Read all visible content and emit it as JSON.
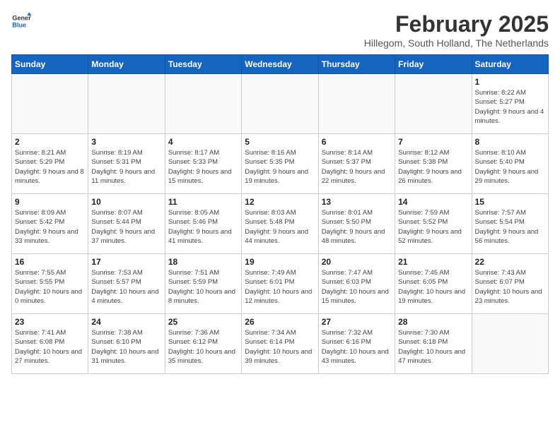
{
  "header": {
    "logo_general": "General",
    "logo_blue": "Blue",
    "month_title": "February 2025",
    "subtitle": "Hillegom, South Holland, The Netherlands"
  },
  "weekdays": [
    "Sunday",
    "Monday",
    "Tuesday",
    "Wednesday",
    "Thursday",
    "Friday",
    "Saturday"
  ],
  "weeks": [
    [
      {
        "day": "",
        "info": ""
      },
      {
        "day": "",
        "info": ""
      },
      {
        "day": "",
        "info": ""
      },
      {
        "day": "",
        "info": ""
      },
      {
        "day": "",
        "info": ""
      },
      {
        "day": "",
        "info": ""
      },
      {
        "day": "1",
        "info": "Sunrise: 8:22 AM\nSunset: 5:27 PM\nDaylight: 9 hours and 4 minutes."
      }
    ],
    [
      {
        "day": "2",
        "info": "Sunrise: 8:21 AM\nSunset: 5:29 PM\nDaylight: 9 hours and 8 minutes."
      },
      {
        "day": "3",
        "info": "Sunrise: 8:19 AM\nSunset: 5:31 PM\nDaylight: 9 hours and 11 minutes."
      },
      {
        "day": "4",
        "info": "Sunrise: 8:17 AM\nSunset: 5:33 PM\nDaylight: 9 hours and 15 minutes."
      },
      {
        "day": "5",
        "info": "Sunrise: 8:16 AM\nSunset: 5:35 PM\nDaylight: 9 hours and 19 minutes."
      },
      {
        "day": "6",
        "info": "Sunrise: 8:14 AM\nSunset: 5:37 PM\nDaylight: 9 hours and 22 minutes."
      },
      {
        "day": "7",
        "info": "Sunrise: 8:12 AM\nSunset: 5:38 PM\nDaylight: 9 hours and 26 minutes."
      },
      {
        "day": "8",
        "info": "Sunrise: 8:10 AM\nSunset: 5:40 PM\nDaylight: 9 hours and 29 minutes."
      }
    ],
    [
      {
        "day": "9",
        "info": "Sunrise: 8:09 AM\nSunset: 5:42 PM\nDaylight: 9 hours and 33 minutes."
      },
      {
        "day": "10",
        "info": "Sunrise: 8:07 AM\nSunset: 5:44 PM\nDaylight: 9 hours and 37 minutes."
      },
      {
        "day": "11",
        "info": "Sunrise: 8:05 AM\nSunset: 5:46 PM\nDaylight: 9 hours and 41 minutes."
      },
      {
        "day": "12",
        "info": "Sunrise: 8:03 AM\nSunset: 5:48 PM\nDaylight: 9 hours and 44 minutes."
      },
      {
        "day": "13",
        "info": "Sunrise: 8:01 AM\nSunset: 5:50 PM\nDaylight: 9 hours and 48 minutes."
      },
      {
        "day": "14",
        "info": "Sunrise: 7:59 AM\nSunset: 5:52 PM\nDaylight: 9 hours and 52 minutes."
      },
      {
        "day": "15",
        "info": "Sunrise: 7:57 AM\nSunset: 5:54 PM\nDaylight: 9 hours and 56 minutes."
      }
    ],
    [
      {
        "day": "16",
        "info": "Sunrise: 7:55 AM\nSunset: 5:55 PM\nDaylight: 10 hours and 0 minutes."
      },
      {
        "day": "17",
        "info": "Sunrise: 7:53 AM\nSunset: 5:57 PM\nDaylight: 10 hours and 4 minutes."
      },
      {
        "day": "18",
        "info": "Sunrise: 7:51 AM\nSunset: 5:59 PM\nDaylight: 10 hours and 8 minutes."
      },
      {
        "day": "19",
        "info": "Sunrise: 7:49 AM\nSunset: 6:01 PM\nDaylight: 10 hours and 12 minutes."
      },
      {
        "day": "20",
        "info": "Sunrise: 7:47 AM\nSunset: 6:03 PM\nDaylight: 10 hours and 15 minutes."
      },
      {
        "day": "21",
        "info": "Sunrise: 7:45 AM\nSunset: 6:05 PM\nDaylight: 10 hours and 19 minutes."
      },
      {
        "day": "22",
        "info": "Sunrise: 7:43 AM\nSunset: 6:07 PM\nDaylight: 10 hours and 23 minutes."
      }
    ],
    [
      {
        "day": "23",
        "info": "Sunrise: 7:41 AM\nSunset: 6:08 PM\nDaylight: 10 hours and 27 minutes."
      },
      {
        "day": "24",
        "info": "Sunrise: 7:38 AM\nSunset: 6:10 PM\nDaylight: 10 hours and 31 minutes."
      },
      {
        "day": "25",
        "info": "Sunrise: 7:36 AM\nSunset: 6:12 PM\nDaylight: 10 hours and 35 minutes."
      },
      {
        "day": "26",
        "info": "Sunrise: 7:34 AM\nSunset: 6:14 PM\nDaylight: 10 hours and 39 minutes."
      },
      {
        "day": "27",
        "info": "Sunrise: 7:32 AM\nSunset: 6:16 PM\nDaylight: 10 hours and 43 minutes."
      },
      {
        "day": "28",
        "info": "Sunrise: 7:30 AM\nSunset: 6:18 PM\nDaylight: 10 hours and 47 minutes."
      },
      {
        "day": "",
        "info": ""
      }
    ]
  ]
}
